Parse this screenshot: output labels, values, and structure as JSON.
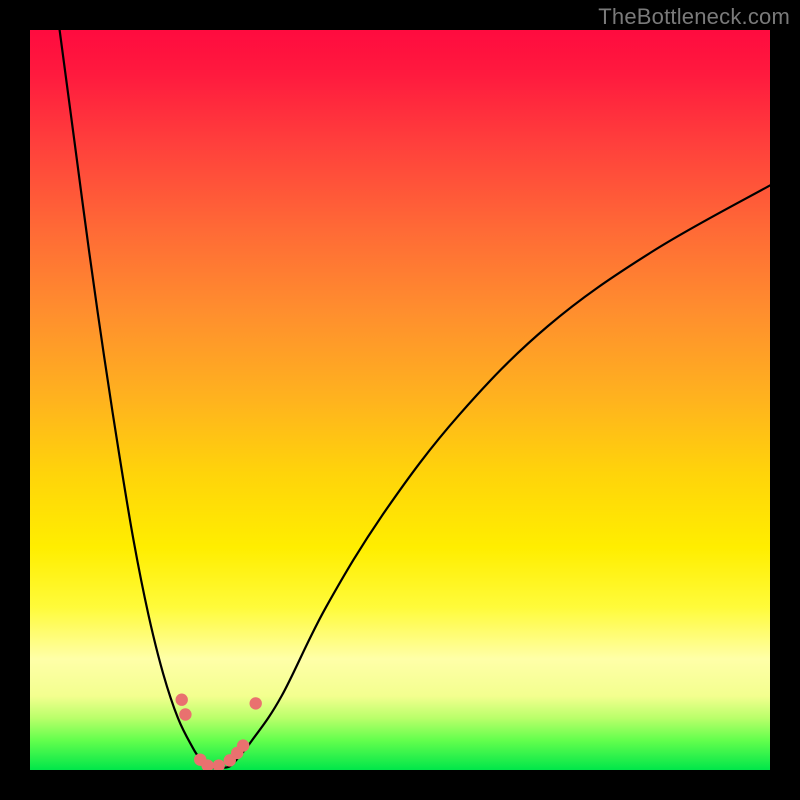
{
  "watermark": "TheBottleneck.com",
  "chart_data": {
    "type": "line",
    "title": "",
    "xlabel": "",
    "ylabel": "",
    "xlim": [
      0,
      100
    ],
    "ylim": [
      0,
      100
    ],
    "series": [
      {
        "name": "bottleneck-curve",
        "x": [
          4,
          6,
          8,
          10,
          12,
          14,
          16,
          18,
          20,
          22,
          23,
          24,
          25,
          26,
          27,
          28,
          30,
          34,
          40,
          48,
          58,
          70,
          84,
          100
        ],
        "y": [
          100,
          85,
          70,
          56,
          43,
          31,
          21,
          13,
          7,
          3,
          1.5,
          0.5,
          0.3,
          0.3,
          0.5,
          1.5,
          4,
          10,
          22,
          35,
          48,
          60,
          70,
          79
        ]
      }
    ],
    "markers": [
      {
        "x": 20.5,
        "y": 9.5
      },
      {
        "x": 21.0,
        "y": 7.5
      },
      {
        "x": 23.0,
        "y": 1.4
      },
      {
        "x": 24.0,
        "y": 0.6
      },
      {
        "x": 25.5,
        "y": 0.6
      },
      {
        "x": 27.0,
        "y": 1.3
      },
      {
        "x": 28.0,
        "y": 2.3
      },
      {
        "x": 28.8,
        "y": 3.3
      },
      {
        "x": 30.5,
        "y": 9.0
      }
    ],
    "marker_color": "#e9716f",
    "curve_color": "#000000",
    "curve_width": 2.2
  }
}
